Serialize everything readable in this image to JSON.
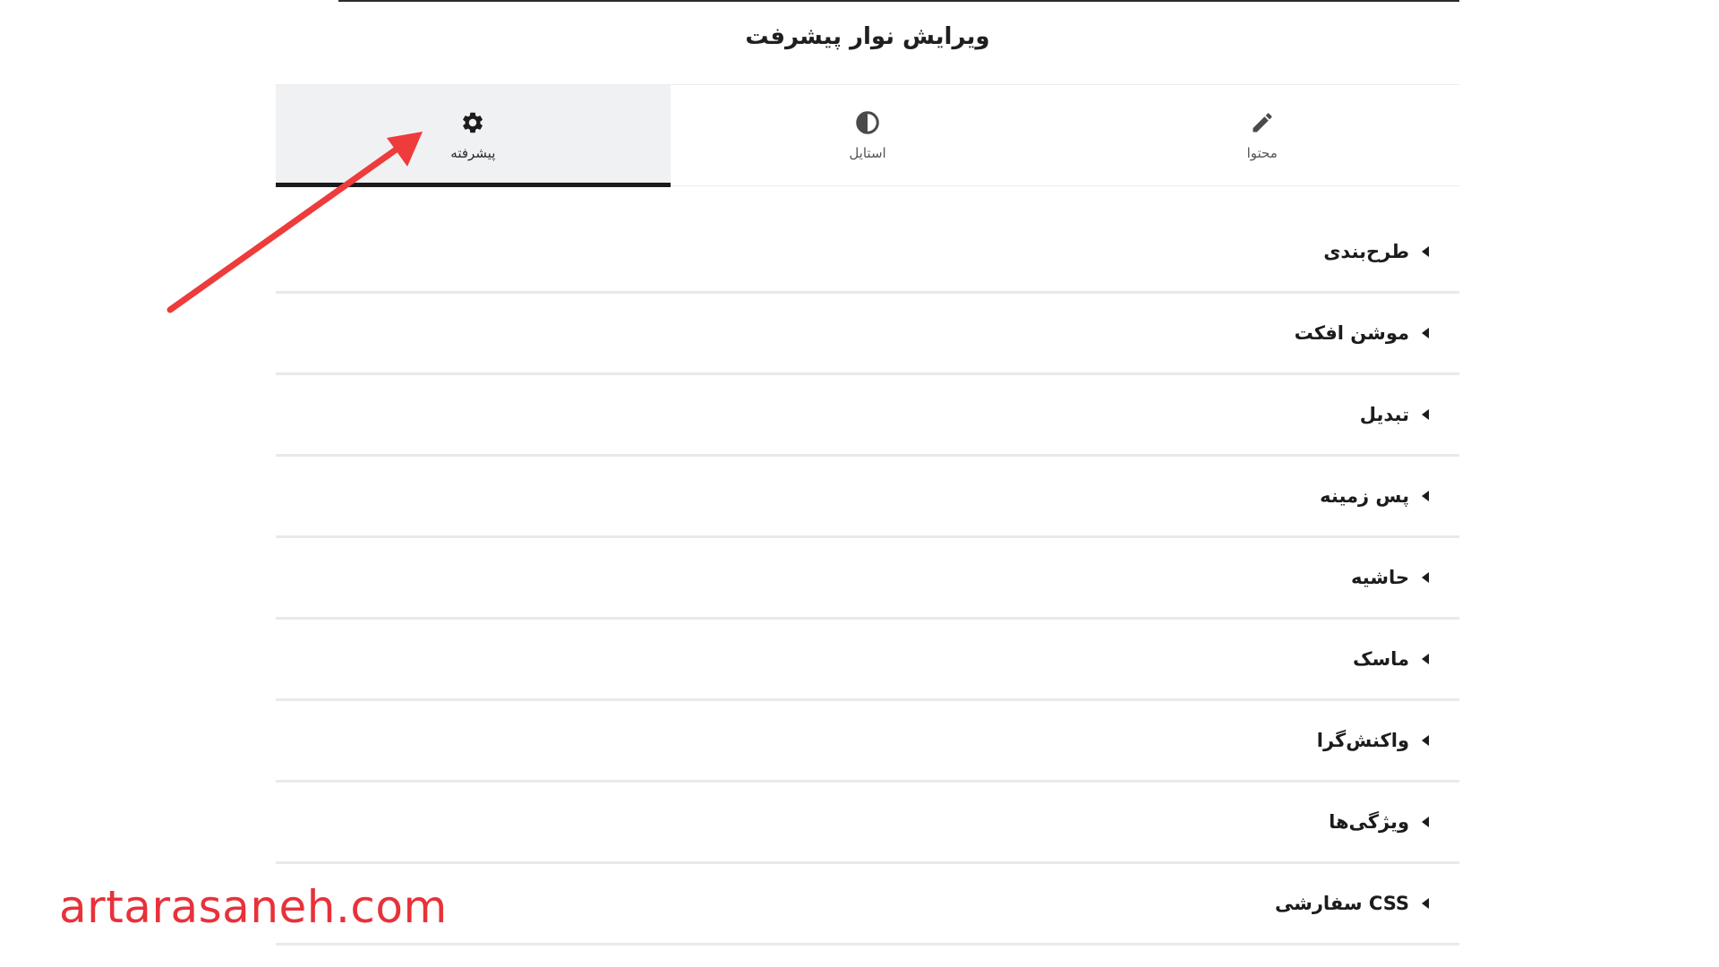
{
  "panel": {
    "title": "ویرایش نوار پیشرفت"
  },
  "tabs": [
    {
      "label": "پیشرفته",
      "icon": "gear-icon",
      "active": true
    },
    {
      "label": "استایل",
      "icon": "contrast-icon",
      "active": false
    },
    {
      "label": "محتوا",
      "icon": "pencil-icon",
      "active": false
    }
  ],
  "sections": [
    {
      "label": "طرح‌بندی"
    },
    {
      "label": "موشن افکت"
    },
    {
      "label": "تبدیل"
    },
    {
      "label": "پس زمینه"
    },
    {
      "label": "حاشیه"
    },
    {
      "label": "ماسک"
    },
    {
      "label": "واکنش‌گرا"
    },
    {
      "label": "ویژگی‌ها"
    },
    {
      "label": "CSS سفارشی"
    }
  ],
  "watermark": {
    "text": "artarasaneh.com"
  },
  "colors": {
    "active_tab_bg": "#f0f1f3",
    "active_indicator": "#1b1b1b",
    "annotation_arrow": "#ee3b3b",
    "watermark": "#e8313a"
  }
}
